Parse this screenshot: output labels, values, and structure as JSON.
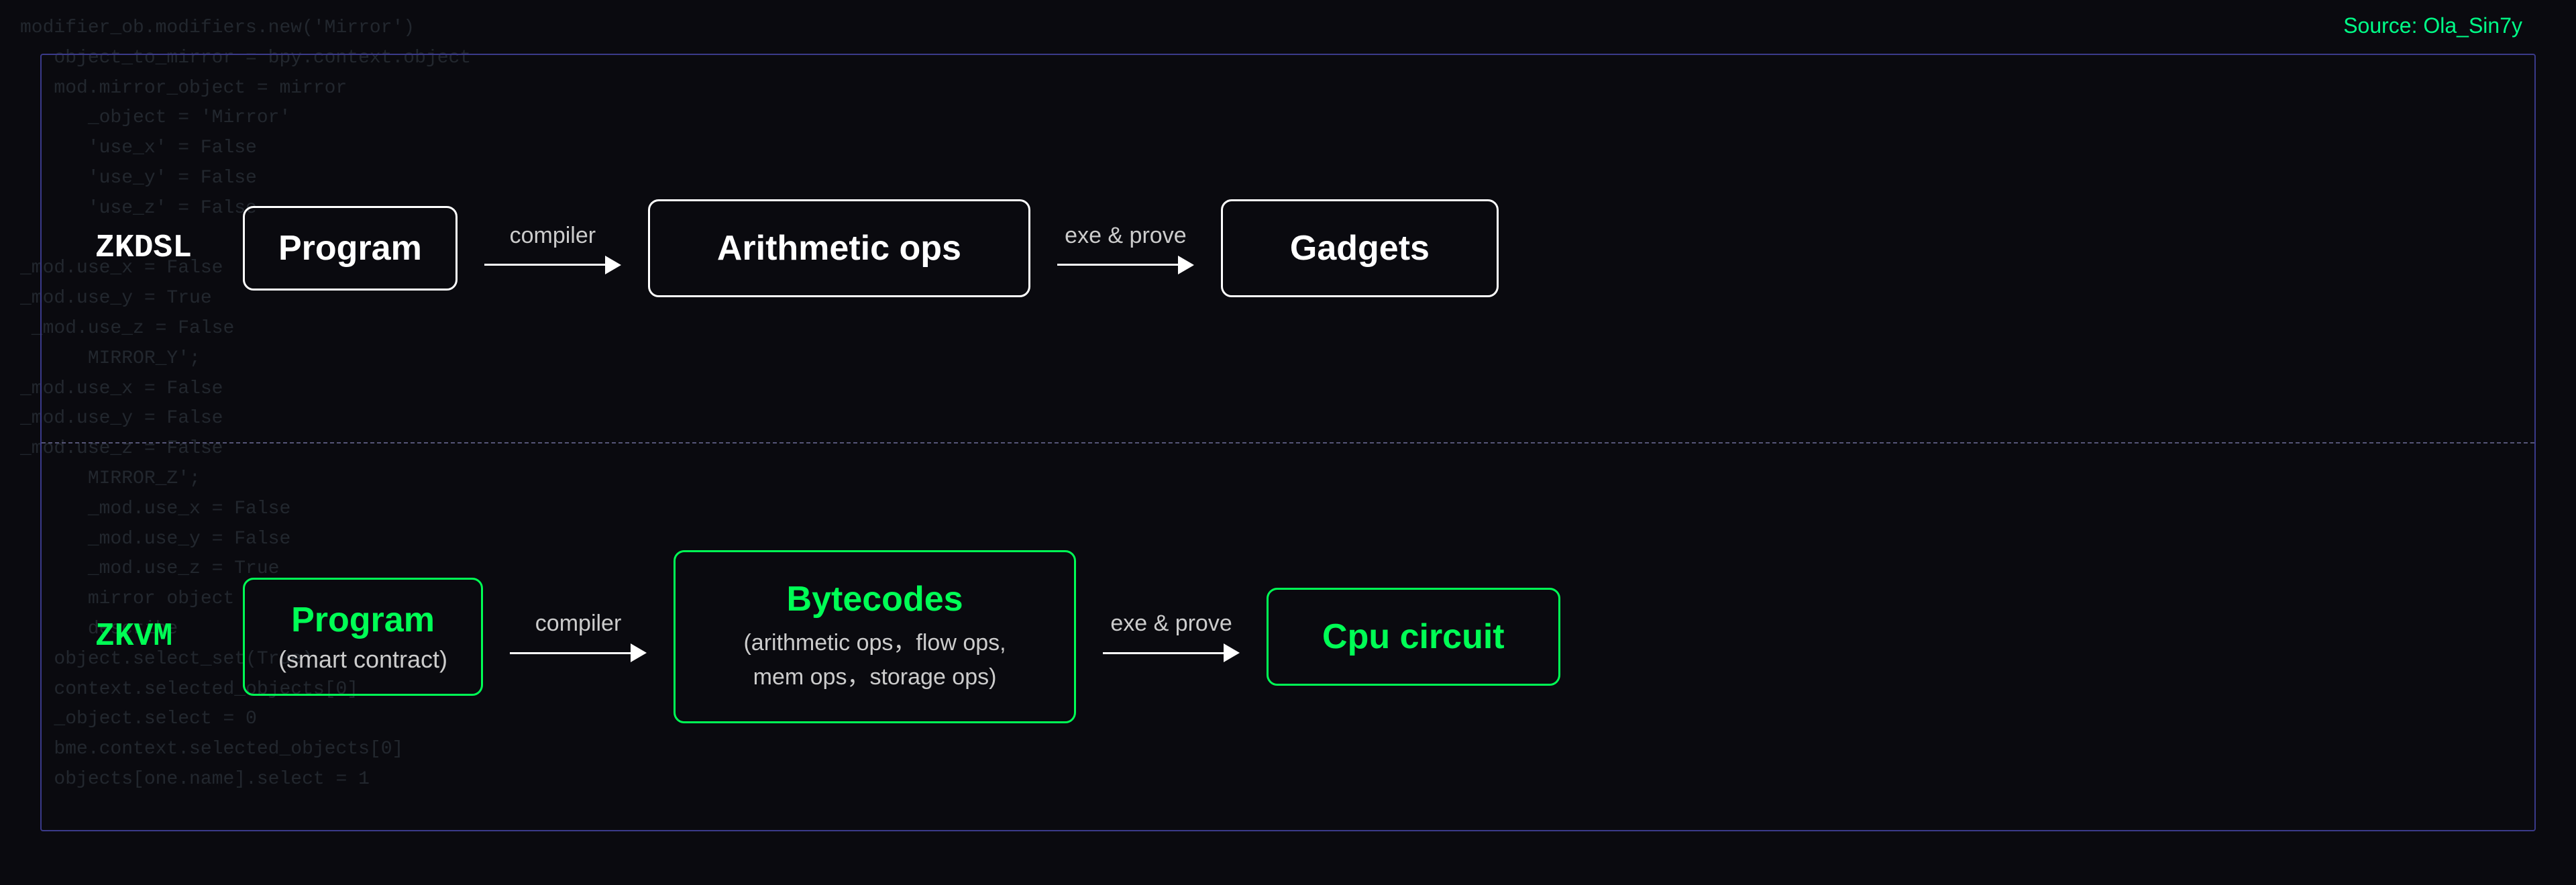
{
  "source": {
    "label": "Source: Ola_Sin7y"
  },
  "background_code": "modifier_ob.modifiers.new('Mirror')\n   object_to_mirror = bpy.context.object\n   mod.mirror_object = mirror\n      _object = 'Mirror'\n      'use_x' = False\n      'use_y' = False\n      'use_z' = False\n\n_mod.use_x = False\n_mod.use_y = True\n _mod.use_z = False\n      MIRROR_Y';\n_mod.use_x = False\n_mod.use_y = False\n_mod.use_z = False\n      MIRROR_Z';\n      _mod.use_x = False\n      _mod.use_y = False\n      _mod.use_z = True\n      mirror object\n      describe\n   object.select_set(True)\n   context.selected_objects[0]\n   _object.select = 0\n   bme.context.selected_objects[0]\n   objects[one.name].select = 1",
  "top_section": {
    "label": "ZKDSL",
    "program_box": {
      "title": "Program"
    },
    "connector1": {
      "label": "compiler",
      "arrow": true
    },
    "arithmetic_box": {
      "title": "Arithmetic ops"
    },
    "connector2": {
      "label": "exe & prove",
      "arrow": true
    },
    "gadgets_box": {
      "title": "Gadgets"
    }
  },
  "bottom_section": {
    "label": "ZKVM",
    "program_box": {
      "title": "Program",
      "subtitle": "(smart contract)"
    },
    "connector1": {
      "label": "compiler",
      "arrow": true
    },
    "bytecodes_box": {
      "title": "Bytecodes",
      "subtitle_line1": "(arithmetic ops，flow ops,",
      "subtitle_line2": "mem ops，storage ops)"
    },
    "connector2": {
      "label": "exe & prove",
      "arrow": true
    },
    "cpu_box": {
      "title": "Cpu circuit"
    }
  }
}
